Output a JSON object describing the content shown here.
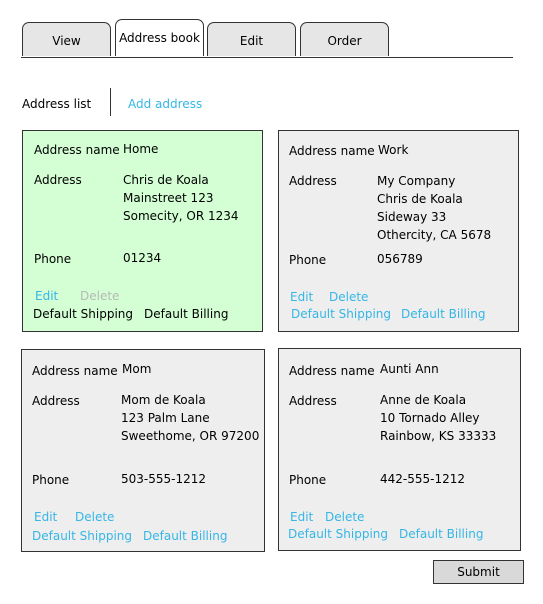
{
  "tabs": [
    "View",
    "Address book",
    "Edit",
    "Order"
  ],
  "subnav": {
    "list_label": "Address list",
    "add_label": "Add address"
  },
  "field_labels": {
    "name": "Address name",
    "address": "Address",
    "phone": "Phone"
  },
  "cards": [
    {
      "name": "Home",
      "address": [
        "Chris de Koala",
        "Mainstreet 123",
        "Somecity, OR 1234"
      ],
      "phone": "01234",
      "edit": "Edit",
      "delete": "Delete",
      "shipping": "Default Shipping",
      "billing": "Default Billing"
    },
    {
      "name": "Work",
      "address": [
        "My Company",
        "Chris de Koala",
        "Sideway 33",
        "Othercity, CA 5678"
      ],
      "phone": "056789",
      "edit": "Edit",
      "delete": "Delete",
      "shipping": "Default Shipping",
      "billing": "Default Billing"
    },
    {
      "name": "Mom",
      "address": [
        "Mom de Koala",
        "123 Palm Lane",
        "Sweethome, OR 97200"
      ],
      "phone": "503-555-1212",
      "edit": "Edit",
      "delete": "Delete",
      "shipping": "Default Shipping",
      "billing": "Default Billing"
    },
    {
      "name": "Aunti Ann",
      "address": [
        "Anne de Koala",
        "10 Tornado Alley",
        "Rainbow, KS 33333"
      ],
      "phone": "442-555-1212",
      "edit": "Edit",
      "delete": "Delete",
      "shipping": "Default Shipping",
      "billing": "Default Billing"
    }
  ],
  "submit_label": "Submit",
  "colors": {
    "link": "#35b6e6",
    "selected_card": "#d4ffd4",
    "card": "#eeeeee",
    "disabled": "#b8b8b8"
  }
}
